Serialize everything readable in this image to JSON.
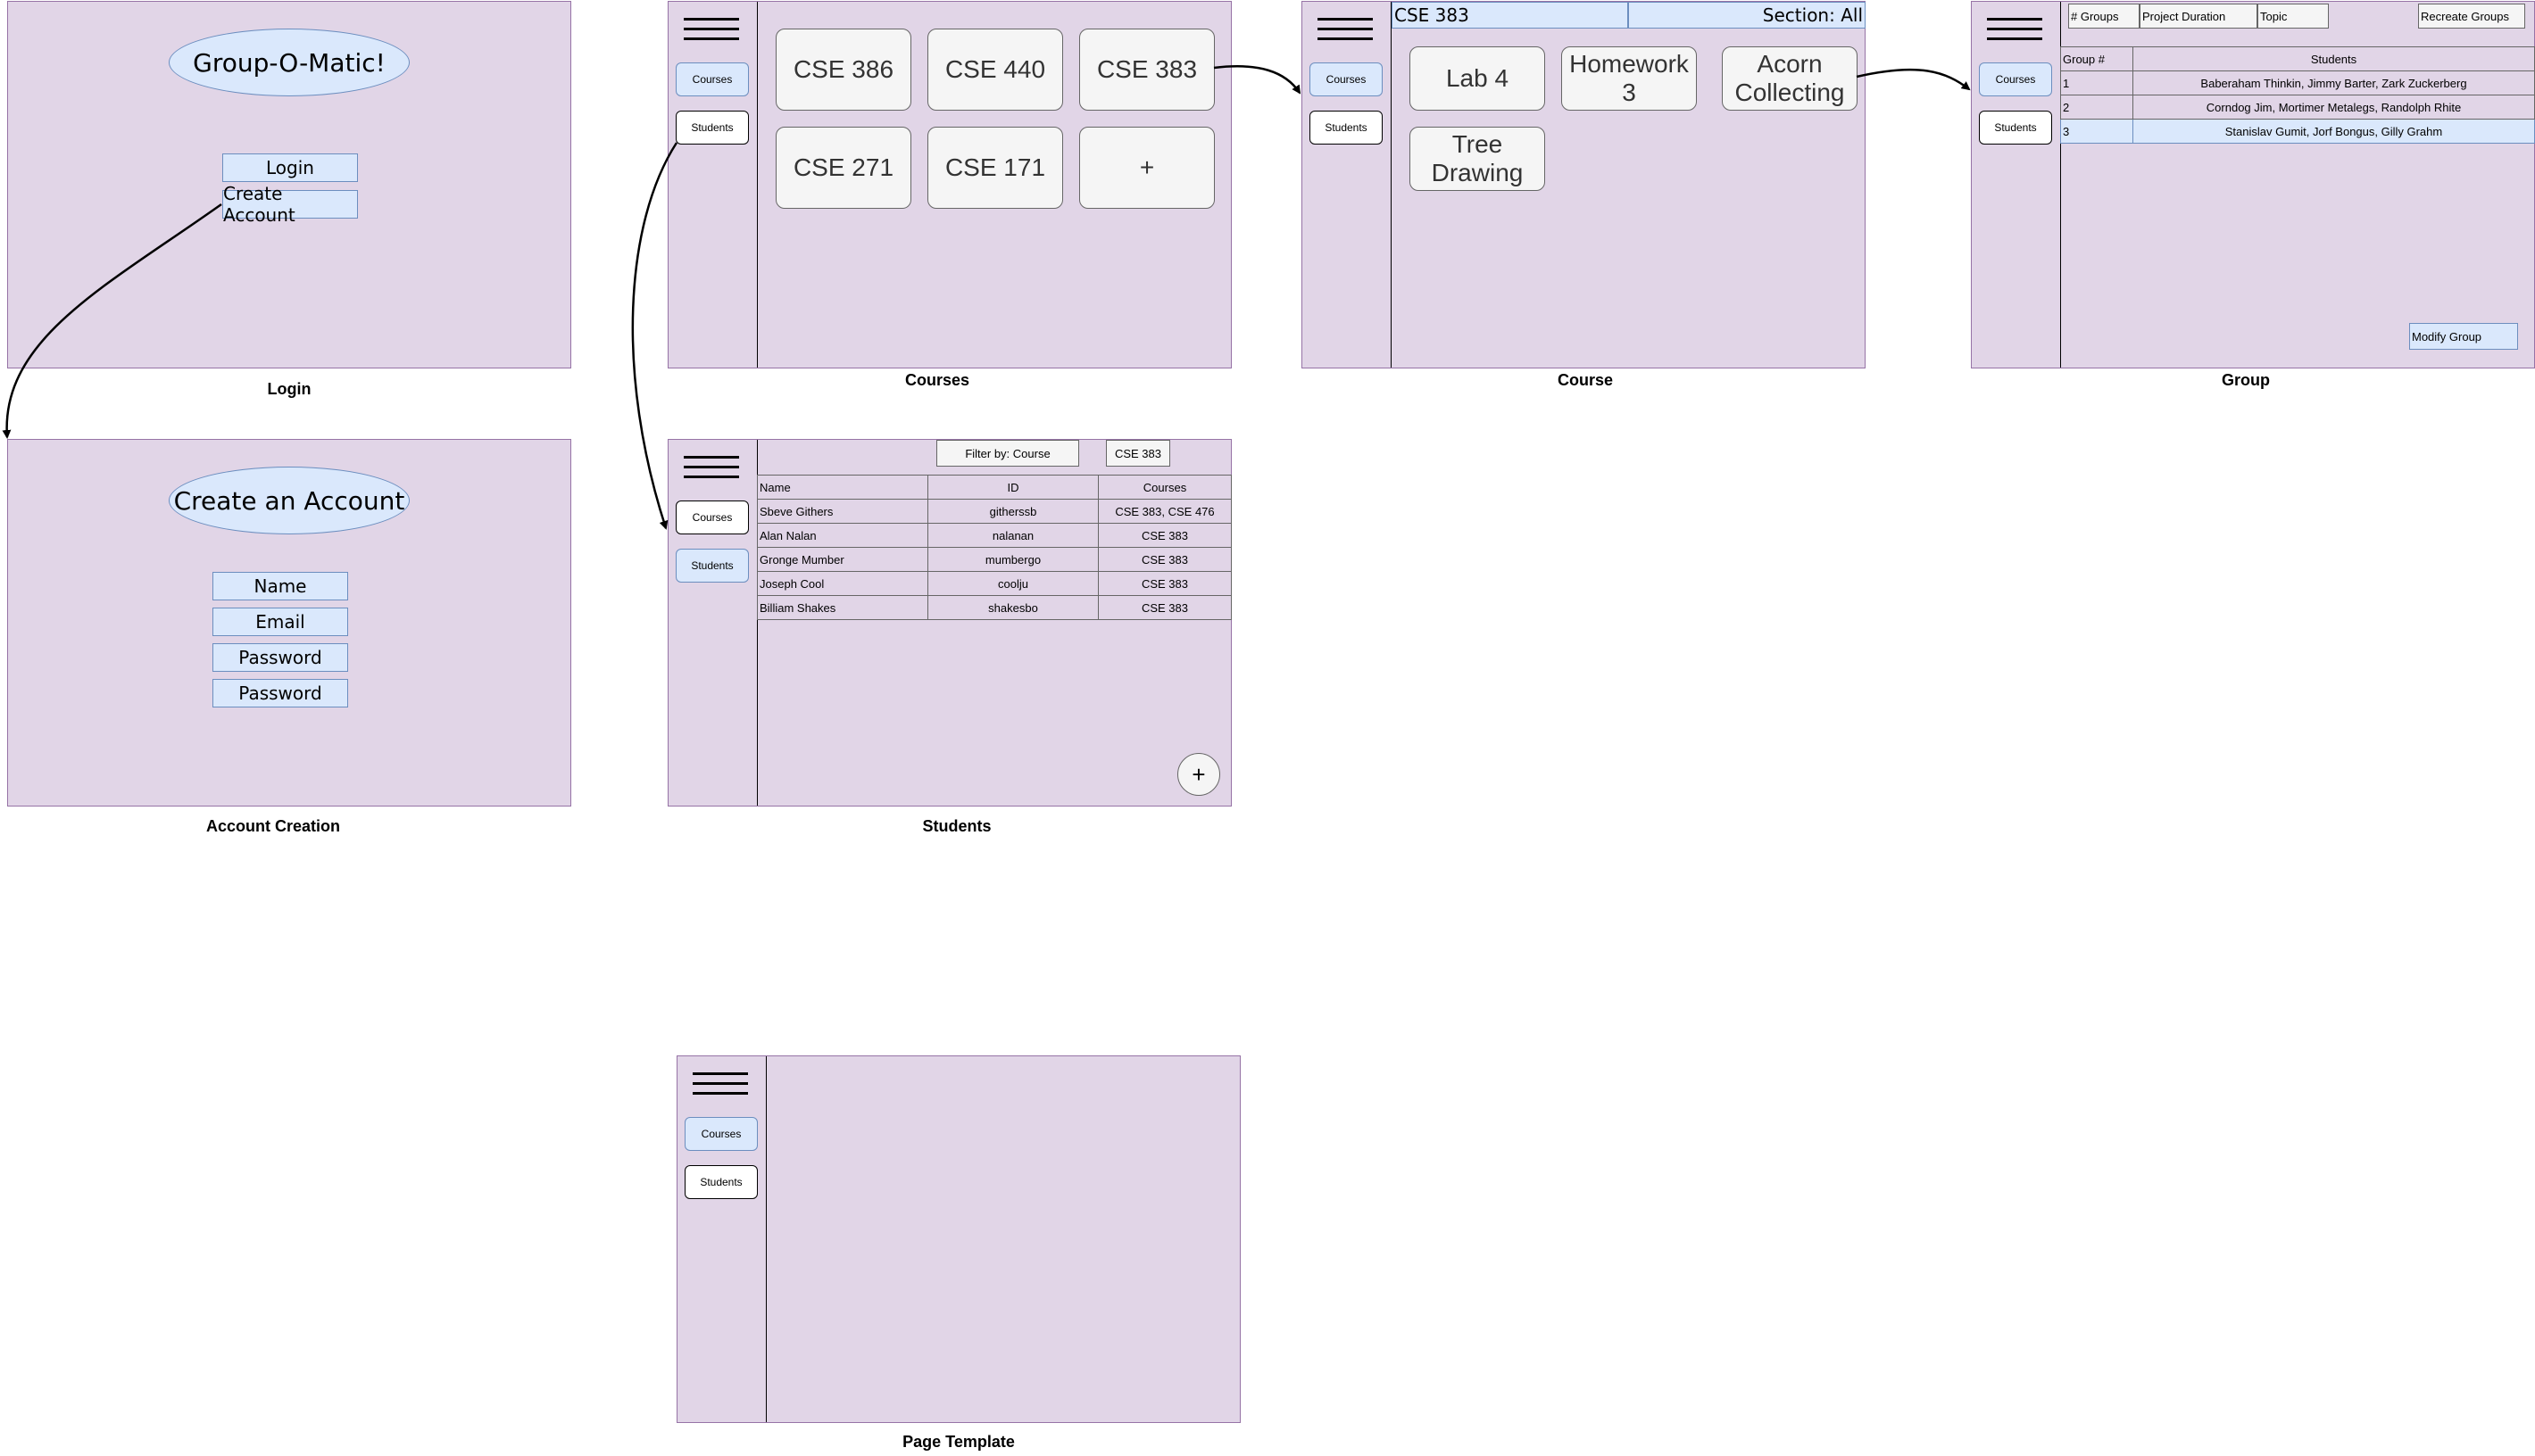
{
  "captions": {
    "login": "Login",
    "courses": "Courses",
    "course": "Course",
    "group": "Group",
    "account_creation": "Account Creation",
    "students": "Students",
    "page_template": "Page Template"
  },
  "login": {
    "title": "Group-O-Matic!",
    "login_button": "Login",
    "create_account_button": "Create Account"
  },
  "create_account": {
    "title": "Create an Account",
    "fields": [
      "Name",
      "Email",
      "Password",
      "Password"
    ]
  },
  "nav": {
    "courses": "Courses",
    "students": "Students"
  },
  "courses": {
    "tiles": [
      "CSE 386",
      "CSE 440",
      "CSE 383",
      "CSE 271",
      "CSE 171",
      "+"
    ]
  },
  "course": {
    "header_course": "CSE 383",
    "header_section": "Section: All",
    "tiles": [
      "Lab 4",
      "Homework 3",
      "Acorn Collecting",
      "Tree Drawing"
    ]
  },
  "group": {
    "controls": [
      "# Groups",
      "Project Duration",
      "Topic"
    ],
    "recreate_button": "Recreate Groups",
    "columns": [
      "Group #",
      "Students"
    ],
    "rows": [
      [
        "1",
        "Baberaham Thinkin, Jimmy Barter, Zark Zuckerberg"
      ],
      [
        "2",
        "Corndog Jim, Mortimer Metalegs, Randolph Rhite"
      ],
      [
        "3",
        "Stanislav Gumit, Jorf Bongus, Gilly Grahm"
      ]
    ],
    "modify_button": "Modify Group"
  },
  "students": {
    "filter_label": "Filter by: Course",
    "filter_value": "CSE 383",
    "columns": [
      "Name",
      "ID",
      "Courses"
    ],
    "rows": [
      [
        "Sbeve Githers",
        "githerssb",
        "CSE 383, CSE 476"
      ],
      [
        "Alan Nalan",
        "nalanan",
        "CSE 383"
      ],
      [
        "Gronge Mumber",
        "mumbergo",
        "CSE 383"
      ],
      [
        "Joseph Cool",
        "coolju",
        "CSE 383"
      ],
      [
        "Billiam Shakes",
        "shakesbo",
        "CSE 383"
      ]
    ],
    "add_button": "+"
  },
  "colors": {
    "frame_fill": "#e1d5e7",
    "frame_stroke": "#9673a6",
    "accent_fill": "#dae8fc",
    "accent_stroke": "#6c8ebf"
  }
}
